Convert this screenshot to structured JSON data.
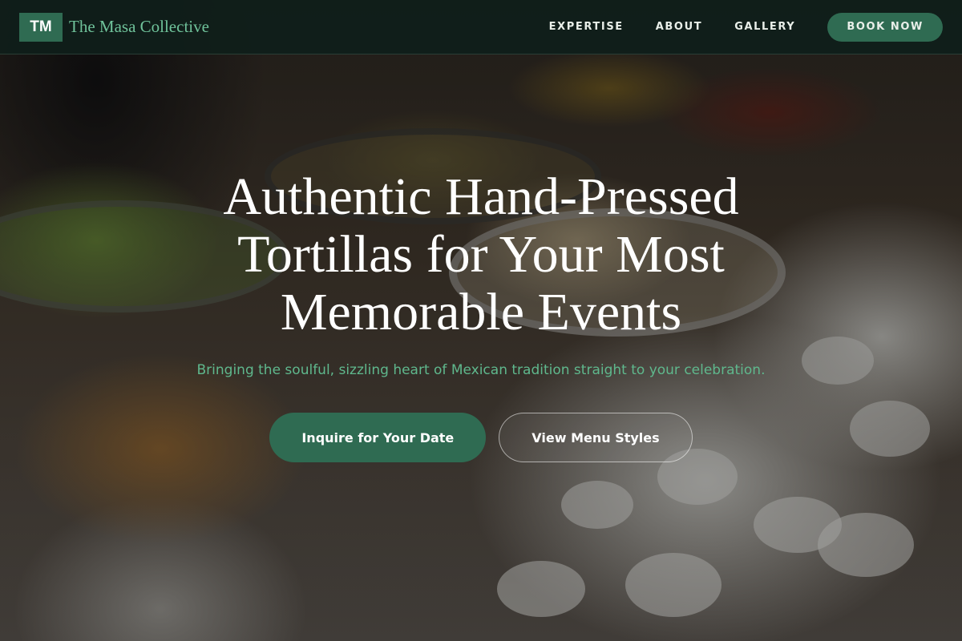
{
  "brand": {
    "mark": "TM",
    "name": "The Masa Collective"
  },
  "nav": {
    "links": [
      {
        "label": "EXPERTISE"
      },
      {
        "label": "ABOUT"
      },
      {
        "label": "GALLERY"
      }
    ],
    "cta_label": "BOOK NOW"
  },
  "hero": {
    "title": "Authentic Hand-Pressed Tortillas for Your Most Memorable Events",
    "subtitle": "Bringing the soulful, sizzling heart of Mexican tradition straight to your celebration.",
    "primary_button": "Inquire for Your Date",
    "secondary_button": "View Menu Styles"
  },
  "colors": {
    "brand_green": "#2f6b52",
    "accent_green": "#5fb88d",
    "navbar_bg": "#0f1e1a"
  }
}
